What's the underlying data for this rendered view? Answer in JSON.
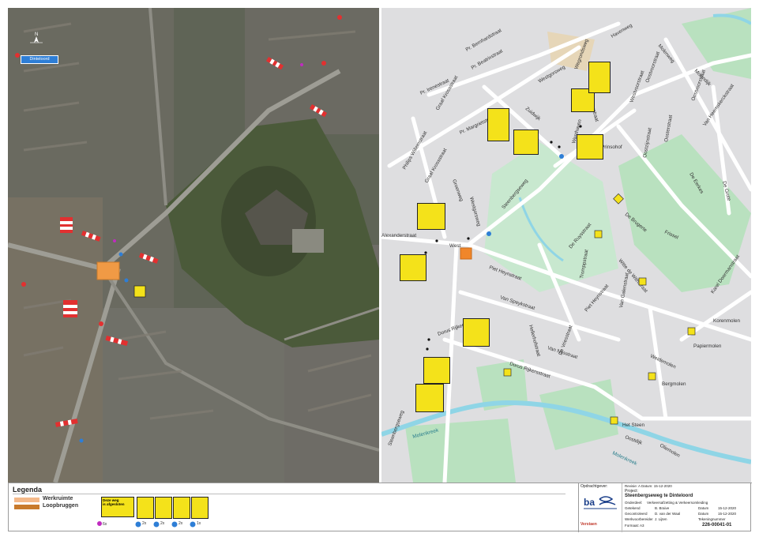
{
  "aerial": {
    "place_label": "Dinteloord",
    "compass_letter": "N"
  },
  "street_map": {
    "streets": [
      "Havenweg",
      "Wegrondsweg",
      "Molenweg",
      "Pr. Bernhardstraat",
      "Pr. Beatrixstraat",
      "Westgorsweg",
      "Westerstraat",
      "Westvoorstraat",
      "Molendijk",
      "Oostvoorstraat",
      "Pr. Irenestraat",
      "Oostvoorstraat",
      "Graaf Krossstraat",
      "Pr. Margrietstraat",
      "Philips Willemstraat",
      "Zuidwijk",
      "Westhaven",
      "Prinsohof",
      "Oostzijnstraat",
      "Van Heemskerckstraat",
      "Oosterstraat",
      "De Eerkes",
      "Graaf Krossstraat",
      "Groenweg",
      "Westgorsweg",
      "Steenbergseweg",
      "De Brugerte",
      "De Grote",
      "De Ruysstraat",
      "Alexanderstraat",
      "West",
      "Piet Heynstraat",
      "Tromppstraat",
      "Witte de Withstraat",
      "Van Speykstraat",
      "Van Galenstraat",
      "Piet Heynstraat",
      "Hellerhofstraat",
      "Van Nesstraat",
      "Dorus Rijkersstraat",
      "De Vriesstraat",
      "Dorus Rijkersstraat",
      "Steenbergseweg",
      "Karel Doormanstraat",
      "Korenmolen",
      "Weidemolen",
      "Papiermolen",
      "Bergmolen",
      "Oliemolen",
      "Het Steen",
      "Oostdijk",
      "Frissel"
    ],
    "waterway_label": "Molenkreek"
  },
  "legend": {
    "title": "Legenda",
    "items": [
      {
        "label": "Werkruimte",
        "color": "#f4b98a"
      },
      {
        "label": "Loopbruggen",
        "color": "#c87a2c"
      }
    ],
    "signs": [
      {
        "text": "Deze weg\nis afgesloten",
        "count": "5x"
      },
      {
        "text": "2 t/m 5",
        "count": "6x"
      }
    ],
    "counts": [
      "6x",
      "2x",
      "2x",
      "2x",
      "1x"
    ]
  },
  "titleblock": {
    "client_label": "Opdrachtgever:",
    "company": "Verstaen",
    "project_label": "Project:",
    "project_name": "Steenbergseweg te Dinteloord",
    "revision": "Revisie: A  Datum: 15-12-2020",
    "rows": [
      {
        "label": "Onderdeel:",
        "value": "Verkeersafzetting & Verkeersomleiding"
      },
      {
        "label": "Getekend",
        "value": "B. Braive"
      },
      {
        "label": "Gecontroleerd",
        "value": "D. van der Waal"
      },
      {
        "label": "Werkvoorbereider",
        "value": "J. Lijten"
      }
    ],
    "datum_label": "Datum",
    "datum_1": "15-12-2020",
    "datum_2": "15-12-2020",
    "tekening_label": "Tekeningnummer",
    "tekening_nr": "226-00041-01",
    "format": "Formaat: A3"
  },
  "colors": {
    "sign_yellow": "#f4e21a",
    "water": "#8fd5e6",
    "green": "#bfe3bf",
    "work_orange": "#f4b98a",
    "bridge_brown": "#c87a2c"
  }
}
